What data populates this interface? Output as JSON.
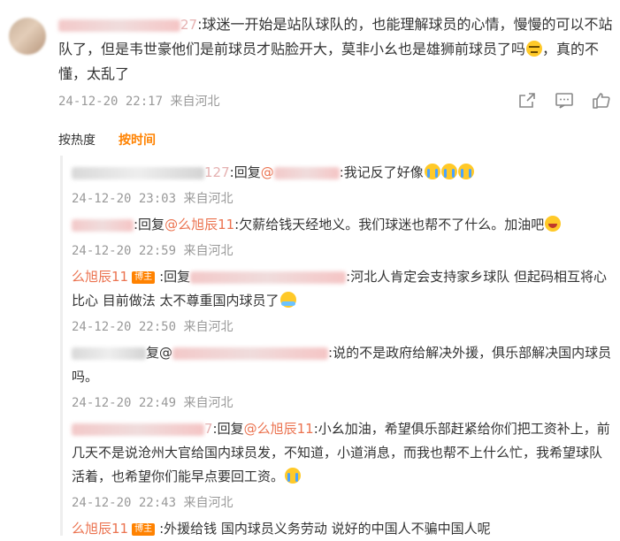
{
  "main_comment": {
    "user_suffix": "27",
    "text": ":球迷一开始是站队球队的，也能理解球员的心情，慢慢的可以不站队了，但是韦世豪他们是前球员才贴脸开大，莫非小幺也是雄狮前球员了吗",
    "text_after": "，真的不懂，太乱了",
    "timestamp": "24-12-20 22:17",
    "location": "来自河北"
  },
  "sort_tabs": {
    "hot": "按热度",
    "time": "按时间"
  },
  "replies": [
    {
      "user_suffix": "127",
      "reply_word": ":回复",
      "reply_target_prefix": "@",
      "text": ":我记反了好像",
      "emojis": [
        "cry",
        "cry",
        "cry"
      ],
      "timestamp": "24-12-20 23:03",
      "location": "来自河北"
    },
    {
      "reply_word": ":回复",
      "reply_target": "@么旭辰11",
      "text": ":欠薪给钱天经地义。我们球迷也帮不了什么。加油吧",
      "emojis": [
        "laugh"
      ],
      "timestamp": "24-12-20 22:59",
      "location": "来自河北"
    },
    {
      "username": "么旭辰11",
      "badge": "博主",
      "reply_word": ":回复",
      "text": ":河北人肯定会支持家乡球队 但起码相互将心比心  目前做法 太不尊重国内球员了",
      "emojis": [
        "hug"
      ],
      "timestamp": "24-12-20 22:50",
      "location": "来自河北"
    },
    {
      "reply_word": "复@",
      "text": ":说的不是政府给解决外援，俱乐部解决国内球员吗。",
      "timestamp": "24-12-20 22:49",
      "location": "来自河北"
    },
    {
      "user_suffix": "7",
      "reply_word": ":回复",
      "reply_target": "@么旭辰11",
      "text": ":小幺加油，希望俱乐部赶紧给你们把工资补上，前几天不是说沧州大官给国内球员发，不知道，小道消息，而我也帮不上什么忙，我希望球队活着，也希望你们能早点要回工资。",
      "emojis": [
        "cry"
      ],
      "timestamp": "24-12-20 22:43",
      "location": "来自河北"
    },
    {
      "username": "么旭辰11",
      "badge": "博主",
      "text": ":外援给钱 国内球员义务劳动 说好的中国人不骗中国人呢"
    }
  ],
  "icons": [
    "share-icon",
    "comment-icon",
    "like-icon"
  ]
}
